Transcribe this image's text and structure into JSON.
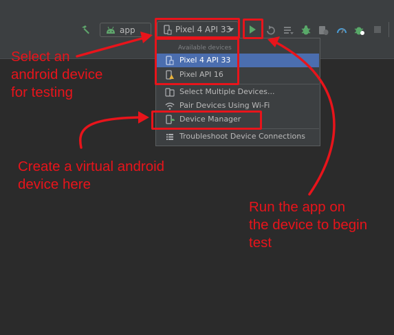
{
  "toolbar": {
    "run_config": "app",
    "device_selected": "Pixel 4 API 33",
    "icons": [
      "hammer-icon",
      "android-icon",
      "phone-icon",
      "run-icon",
      "rerun-icon",
      "apply-changes-icon",
      "debug-icon",
      "attach-debugger-icon",
      "profile-icon",
      "coverage-icon",
      "stop-icon"
    ]
  },
  "device_menu": {
    "header": "Available devices",
    "devices": [
      {
        "label": "Pixel 4 API 33",
        "selected": true
      },
      {
        "label": "Pixel API 16",
        "selected": false
      }
    ],
    "actions": [
      {
        "label": "Select Multiple Devices..."
      },
      {
        "label": "Pair Devices Using Wi-Fi"
      },
      {
        "label": "Device Manager"
      },
      {
        "label": "Troubleshoot Device Connections"
      }
    ]
  },
  "annotations": {
    "select_device": "Select an\nandroid device\nfor testing",
    "create_virtual": "Create a virtual android\ndevice here",
    "run_app": "Run the app on\nthe device to begin\ntest"
  },
  "colors": {
    "annotation": "#e8141b",
    "selection": "#4b6eaf",
    "run_green": "#59a869",
    "toolbar_bg": "#3c3f41",
    "editor_bg": "#2b2b2b"
  }
}
